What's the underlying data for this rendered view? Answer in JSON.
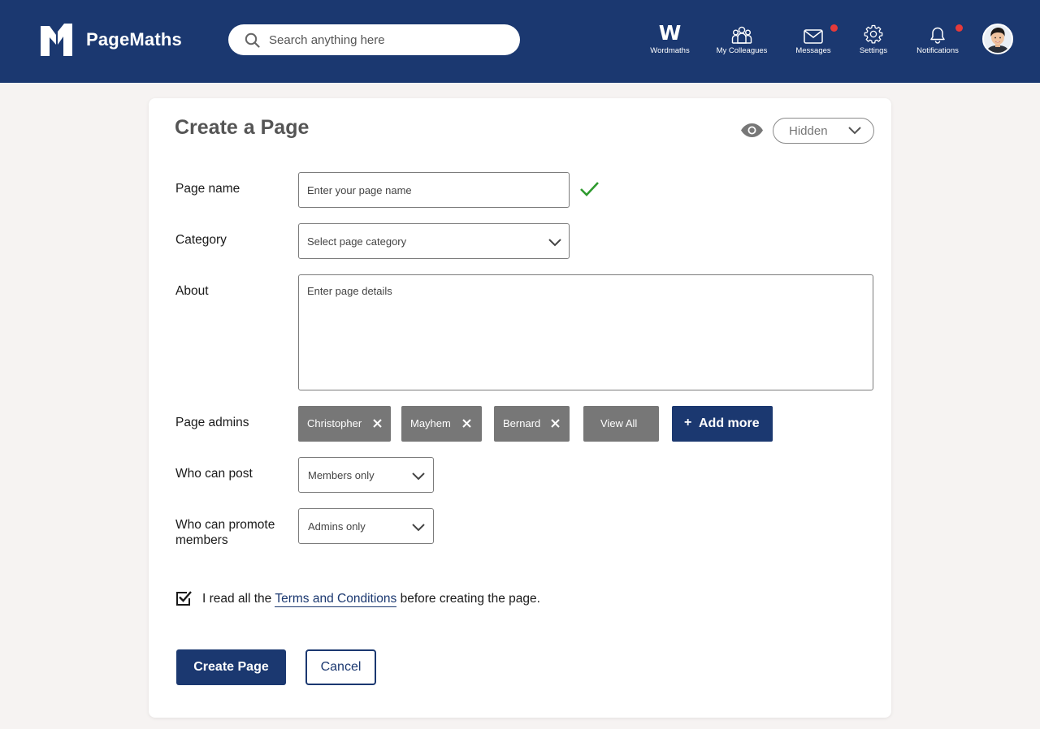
{
  "header": {
    "brand": "PageMaths",
    "search": {
      "placeholder": "Search anything here"
    },
    "nav": {
      "wordmaths": {
        "glyph": "W",
        "label": "Wordmaths"
      },
      "colleagues": {
        "label": "My Colleagues"
      },
      "messages": {
        "label": "Messages",
        "has_badge": true
      },
      "settings": {
        "label": "Settings"
      },
      "notifications": {
        "label": "Notifications",
        "has_badge": true
      }
    }
  },
  "form": {
    "title": "Create a Page",
    "visibility": {
      "value": "Hidden"
    },
    "page_name": {
      "label": "Page name",
      "placeholder": "Enter your page name",
      "valid": true
    },
    "category": {
      "label": "Category",
      "value": "Select page category"
    },
    "about": {
      "label": "About",
      "placeholder": "Enter page details"
    },
    "admins": {
      "label": "Page admins",
      "chips": [
        "Christopher",
        "Mayhem",
        "Bernard"
      ],
      "view_all": "View All",
      "add_more": "Add more",
      "add_symbol": "+"
    },
    "who_can_post": {
      "label": "Who can post",
      "value": "Members only"
    },
    "who_can_promote": {
      "label_line1": "Who can promote",
      "label_line2": "members",
      "value": "Admins only"
    },
    "terms": {
      "checked": true,
      "prefix": "I read all the ",
      "link": "Terms and Conditions",
      "suffix": " before creating the page."
    },
    "buttons": {
      "create": "Create Page",
      "cancel": "Cancel"
    }
  },
  "colors": {
    "primary": "#1b3870",
    "badge": "#e63a3a",
    "chip": "#777777",
    "success": "#2e9a2e",
    "background": "#f6f3f2"
  },
  "icons": {
    "search": "search-icon",
    "visibility": "eye-icon",
    "dropdown": "chevron-down-icon",
    "remove": "close-icon",
    "valid": "checkmark-icon"
  }
}
